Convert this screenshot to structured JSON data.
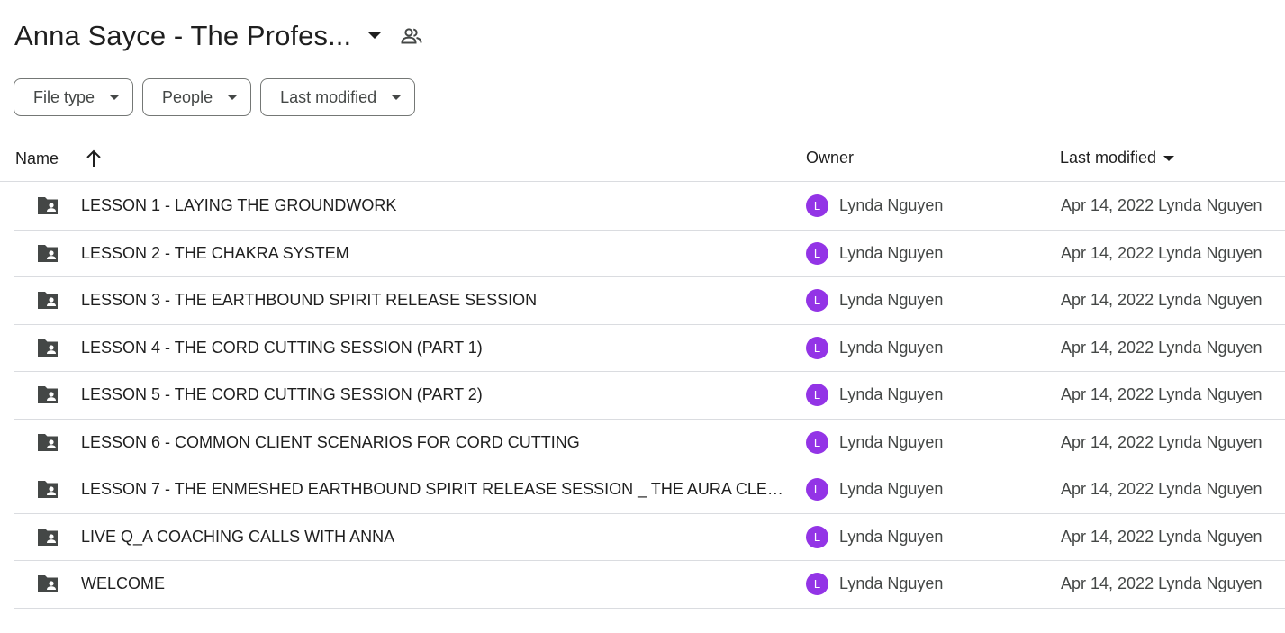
{
  "header": {
    "title": "Anna Sayce - The Profes...",
    "icons": {
      "caret": "arrow-drop-down-icon",
      "shared": "people-icon"
    }
  },
  "filters": [
    {
      "label": "File type"
    },
    {
      "label": "People"
    },
    {
      "label": "Last modified"
    }
  ],
  "table": {
    "columns": {
      "name": "Name",
      "owner": "Owner",
      "last_modified": "Last modified"
    },
    "sort": {
      "column": "name",
      "direction": "ascending"
    },
    "rows": [
      {
        "name": "LESSON 1 - LAYING THE GROUNDWORK",
        "owner_initial": "L",
        "owner": "Lynda Nguyen",
        "modified": "Apr 14, 2022 Lynda Nguyen"
      },
      {
        "name": "LESSON 2 - THE CHAKRA SYSTEM",
        "owner_initial": "L",
        "owner": "Lynda Nguyen",
        "modified": "Apr 14, 2022 Lynda Nguyen"
      },
      {
        "name": "LESSON 3 - THE EARTHBOUND SPIRIT RELEASE SESSION",
        "owner_initial": "L",
        "owner": "Lynda Nguyen",
        "modified": "Apr 14, 2022 Lynda Nguyen"
      },
      {
        "name": "LESSON 4 - THE CORD CUTTING SESSION (PART 1)",
        "owner_initial": "L",
        "owner": "Lynda Nguyen",
        "modified": "Apr 14, 2022 Lynda Nguyen"
      },
      {
        "name": "LESSON 5 - THE CORD CUTTING SESSION (PART 2)",
        "owner_initial": "L",
        "owner": "Lynda Nguyen",
        "modified": "Apr 14, 2022 Lynda Nguyen"
      },
      {
        "name": "LESSON 6 - COMMON CLIENT SCENARIOS FOR CORD CUTTING",
        "owner_initial": "L",
        "owner": "Lynda Nguyen",
        "modified": "Apr 14, 2022 Lynda Nguyen"
      },
      {
        "name": "LESSON 7 - THE ENMESHED EARTHBOUND SPIRIT RELEASE SESSION _ THE AURA CLEA...",
        "owner_initial": "L",
        "owner": "Lynda Nguyen",
        "modified": "Apr 14, 2022 Lynda Nguyen"
      },
      {
        "name": "LIVE Q_A COACHING CALLS WITH ANNA",
        "owner_initial": "L",
        "owner": "Lynda Nguyen",
        "modified": "Apr 14, 2022 Lynda Nguyen"
      },
      {
        "name": "WELCOME",
        "owner_initial": "L",
        "owner": "Lynda Nguyen",
        "modified": "Apr 14, 2022 Lynda Nguyen"
      }
    ]
  },
  "colors": {
    "avatar": "#9334e6",
    "text_primary": "#1f1f1f",
    "text_secondary": "#444746",
    "divider": "#dadce0",
    "icon": "#444746"
  }
}
